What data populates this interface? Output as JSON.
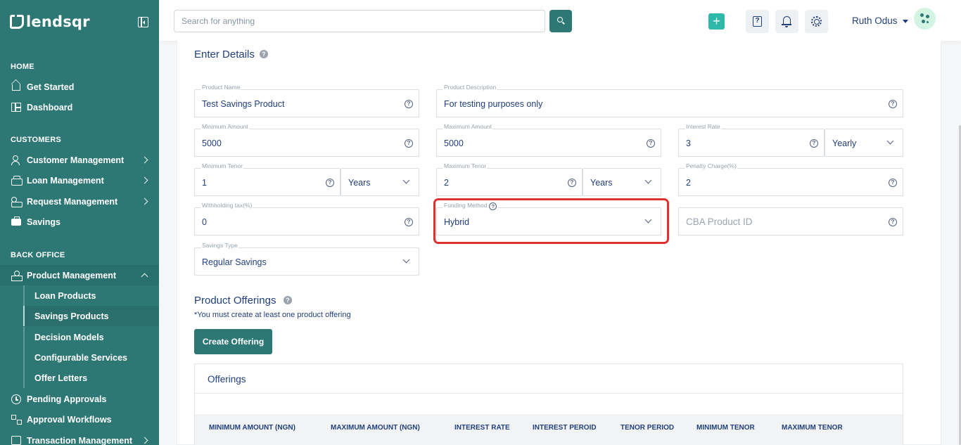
{
  "app": {
    "logo_text": "lendsqr"
  },
  "sidebar": {
    "sections": [
      "HOME",
      "CUSTOMERS",
      "BACK OFFICE"
    ],
    "items": [
      {
        "label": "Get Started"
      },
      {
        "label": "Dashboard"
      },
      {
        "label": "Customer Management"
      },
      {
        "label": "Loan Management"
      },
      {
        "label": "Request Management"
      },
      {
        "label": "Savings"
      },
      {
        "label": "Product Management"
      },
      {
        "label": "Pending Approvals"
      },
      {
        "label": "Approval Workflows"
      },
      {
        "label": "Transaction Management"
      }
    ],
    "sub_items": [
      {
        "label": "Loan Products"
      },
      {
        "label": "Savings Products"
      },
      {
        "label": "Decision Models"
      },
      {
        "label": "Configurable Services"
      },
      {
        "label": "Offer Letters"
      }
    ]
  },
  "header": {
    "search_placeholder": "Search for anything",
    "user_name": "Ruth Odus",
    "plus": "+"
  },
  "form": {
    "section_title": "Enter Details",
    "product_name": {
      "label": "Product Name",
      "value": "Test Savings Product"
    },
    "product_description": {
      "label": "Product Description",
      "value": "For testing purposes only"
    },
    "minimum_amount": {
      "label": "Minimum Amount",
      "value": "5000"
    },
    "maximum_amount": {
      "label": "Maximum Amount",
      "value": "5000"
    },
    "interest_rate": {
      "label": "Interest Rate",
      "value": "3",
      "period": "Yearly"
    },
    "minimum_tenor": {
      "label": "Minimum Tenor",
      "value": "1",
      "unit": "Years"
    },
    "maximum_tenor": {
      "label": "Maximum Tenor",
      "value": "2",
      "unit": "Years"
    },
    "penalty_charge": {
      "label": "Penalty Charge(%)",
      "value": "2"
    },
    "withholding_tax": {
      "label": "Withholding tax(%)",
      "value": "0"
    },
    "funding_method": {
      "label": "Funding Method",
      "value": "Hybrid"
    },
    "cba_product_id": {
      "placeholder": "CBA Product ID"
    },
    "savings_type": {
      "label": "Savings Type",
      "value": "Regular Savings"
    }
  },
  "offerings": {
    "section_title": "Product Offerings",
    "note": "*You must create at least one product offering",
    "create_button": "Create Offering",
    "table_title": "Offerings",
    "columns": [
      "MINIMUM AMOUNT (NGN)",
      "MAXIMUM AMOUNT (NGN)",
      "INTEREST RATE",
      "INTEREST PEROID",
      "TENOR PERIOD",
      "MINIMUM TENOR",
      "MAXIMUM TENOR"
    ]
  },
  "colors": {
    "brand": "#2d7775",
    "text": "#213f7d",
    "highlight": "#e03131",
    "accent": "#2fb9a8"
  }
}
